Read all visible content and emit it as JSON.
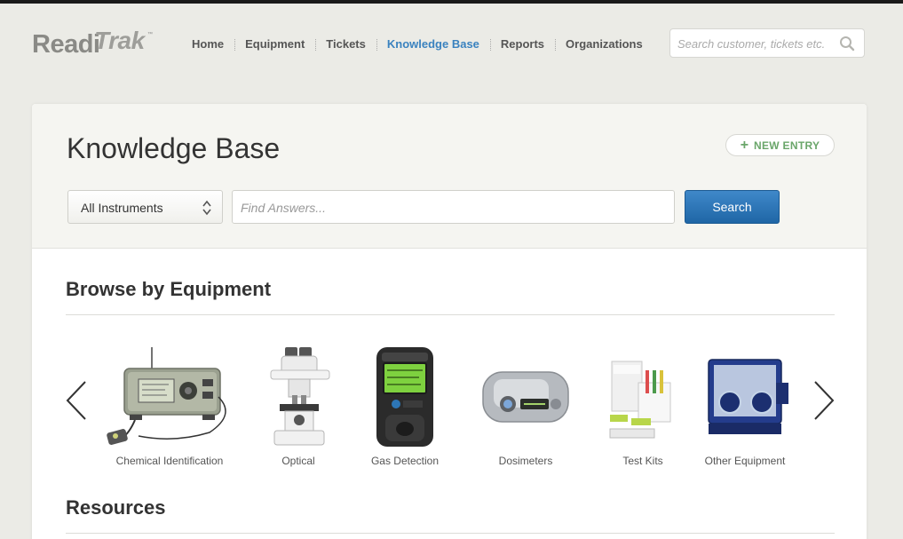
{
  "brand": {
    "part1": "Readi",
    "part2": "Trak",
    "tm": "™"
  },
  "nav": {
    "items": [
      {
        "label": "Home",
        "active": false
      },
      {
        "label": "Equipment",
        "active": false
      },
      {
        "label": "Tickets",
        "active": false
      },
      {
        "label": "Knowledge Base",
        "active": true
      },
      {
        "label": "Reports",
        "active": false
      },
      {
        "label": "Organizations",
        "active": false
      }
    ]
  },
  "top_search": {
    "placeholder": "Search customer, tickets etc.",
    "icon": "search-icon"
  },
  "page": {
    "title": "Knowledge Base",
    "new_entry_label": "NEW ENTRY",
    "instrument_select": {
      "value": "All Instruments"
    },
    "find_input": {
      "placeholder": "Find Answers..."
    },
    "search_button": "Search"
  },
  "browse": {
    "title": "Browse by Equipment",
    "items": [
      {
        "label": "Chemical Identification",
        "icon": "chemical-analyzer-icon"
      },
      {
        "label": "Optical",
        "icon": "microscope-icon"
      },
      {
        "label": "Gas Detection",
        "icon": "gas-detector-icon"
      },
      {
        "label": "Dosimeters",
        "icon": "dosimeter-icon"
      },
      {
        "label": "Test Kits",
        "icon": "test-kit-icon"
      },
      {
        "label": "Other Equipment",
        "icon": "glovebox-icon"
      }
    ]
  },
  "resources": {
    "title": "Resources"
  },
  "colors": {
    "accent": "#3a82bf",
    "button": "#2a74b8",
    "new_entry": "#6aa66a",
    "background": "#ebebe6"
  }
}
